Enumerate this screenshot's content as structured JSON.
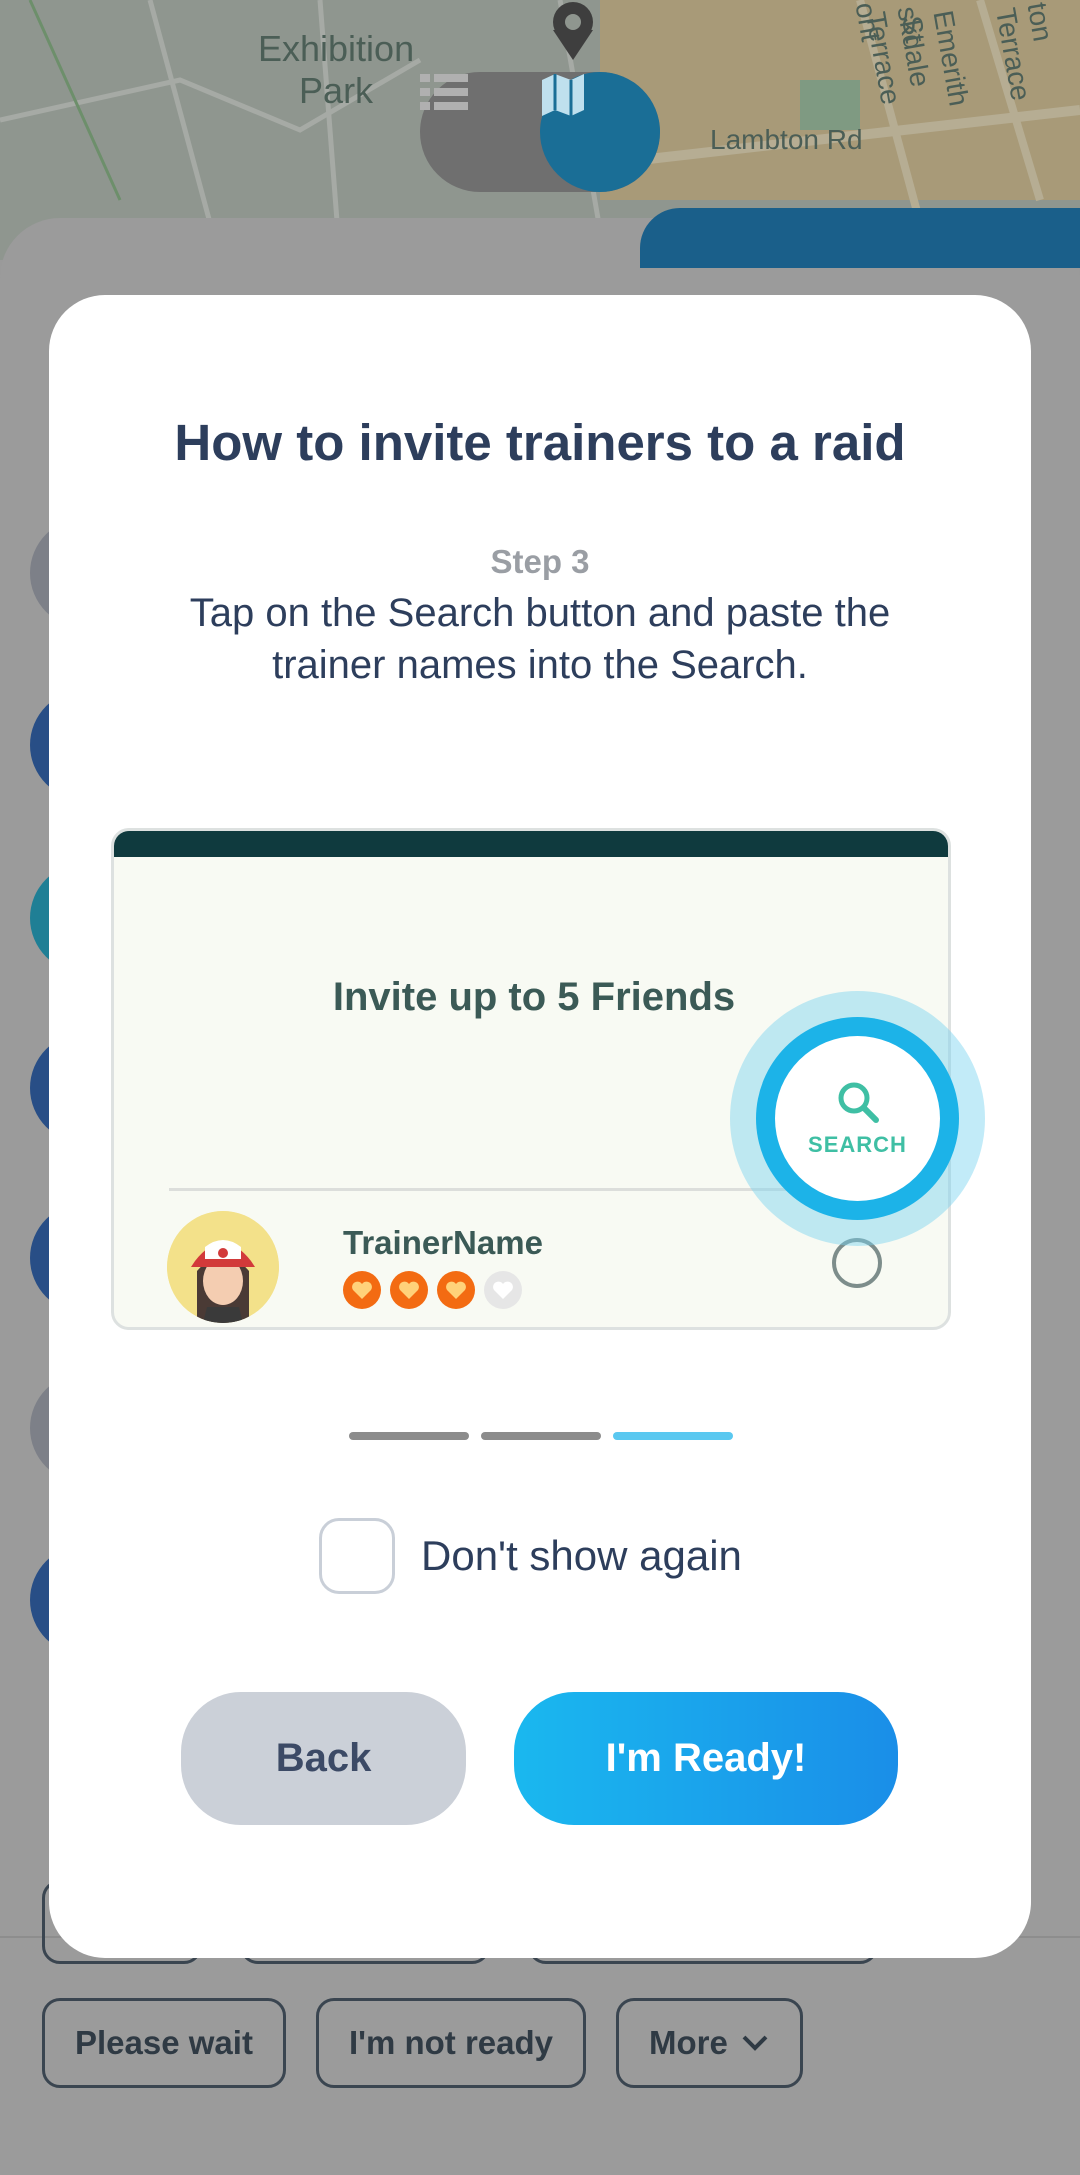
{
  "map": {
    "labels": {
      "park": "Exhibition\nPark",
      "road1": "Lambton Rd",
      "road2": "Emerith St",
      "road3": "skdale Terrace",
      "road4": "ton Terrace",
      "road5": "ont"
    },
    "view_toggle": {
      "list_icon": "list-icon",
      "map_icon": "map-icon"
    }
  },
  "background": {
    "quick_replies": [
      "Please wait",
      "I'm not ready",
      "More"
    ],
    "more_icon": "chevron-down-icon"
  },
  "modal": {
    "title": "How to invite trainers to a raid",
    "step_label": "Step 3",
    "step_text": "Tap on the Search button and paste the trainer names into the Search.",
    "illustration": {
      "heading": "Invite up to 5 Friends",
      "search_label": "SEARCH",
      "trainer_name": "TrainerName",
      "friendship_hearts": {
        "filled": 3,
        "total": 4
      }
    },
    "pager": {
      "total": 3,
      "current": 3
    },
    "dont_show_label": "Don't show again",
    "back_label": "Back",
    "ready_label": "I'm Ready!"
  },
  "colors": {
    "accent": "#1cb3e8",
    "title": "#2d3e5c",
    "heart": "#f36b12"
  }
}
